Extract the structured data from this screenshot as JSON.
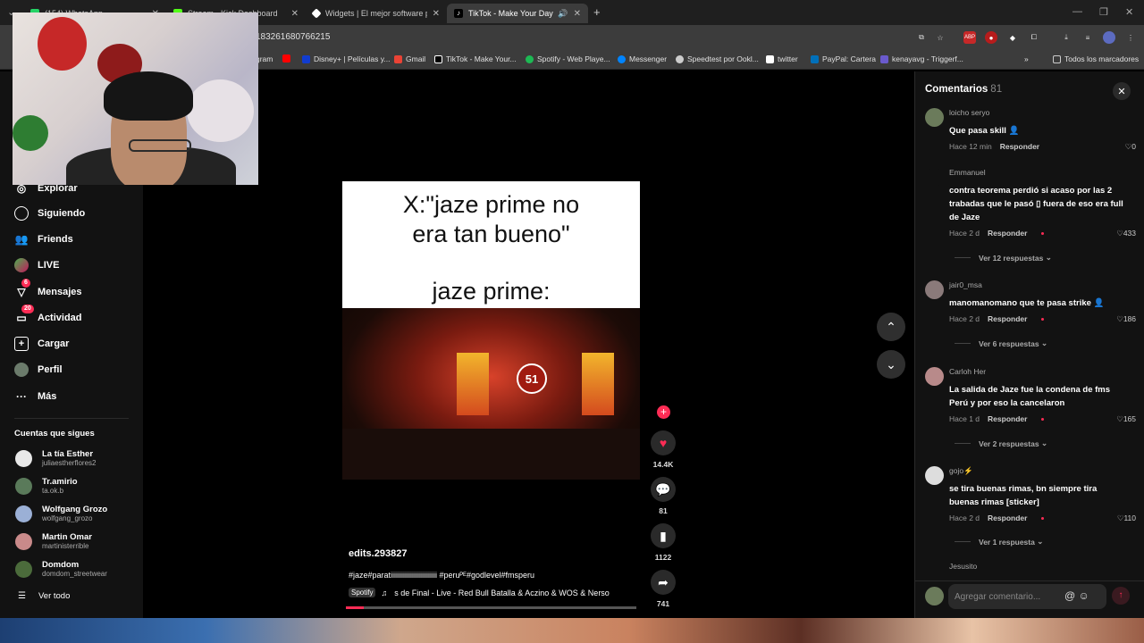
{
  "browser": {
    "tabs": [
      {
        "label": "(154) WhatsApp",
        "color": "#25d366"
      },
      {
        "label": "Stream - Kick Dashboard",
        "color": "#53fc18"
      },
      {
        "label": "Widgets | El mejor software pa",
        "color": "#ffffff"
      },
      {
        "label": "TikTok - Make Your Day",
        "color": "#ffffff"
      }
    ],
    "active_tab": 3,
    "url": "183261680766215",
    "bookmarks": [
      {
        "label": "gram",
        "color": "#c13584"
      },
      {
        "label": "",
        "color": "#ff0000"
      },
      {
        "label": "Disney+ | Películas y...",
        "color": "#113ccf"
      },
      {
        "label": "Gmail",
        "color": "#ea4335"
      },
      {
        "label": "TikTok - Make Your...",
        "color": "#ffffff"
      },
      {
        "label": "Spotify - Web Playe...",
        "color": "#1db954"
      },
      {
        "label": "Messenger",
        "color": "#0084ff"
      },
      {
        "label": "Speedtest por Ookl...",
        "color": "#cccccc"
      },
      {
        "label": "twitter",
        "color": "#ffffff"
      },
      {
        "label": "PayPal: Cartera",
        "color": "#0070ba"
      },
      {
        "label": "kenayavg - Triggerf...",
        "color": "#6a5acd"
      }
    ],
    "all_bookmarks_label": "Todos los marcadores",
    "extensions": [
      "ABP",
      "●",
      "◆"
    ]
  },
  "nav": {
    "items": [
      {
        "label": "Explorar",
        "icon": "compass-icon",
        "badge": ""
      },
      {
        "label": "Siguiendo",
        "icon": "following-icon",
        "badge": ""
      },
      {
        "label": "Friends",
        "icon": "friends-icon",
        "badge": ""
      },
      {
        "label": "LIVE",
        "icon": "live-icon",
        "badge": ""
      },
      {
        "label": "Mensajes",
        "icon": "messages-icon",
        "badge": "6"
      },
      {
        "label": "Actividad",
        "icon": "activity-icon",
        "badge": "20"
      },
      {
        "label": "Cargar",
        "icon": "upload-icon",
        "badge": ""
      },
      {
        "label": "Perfil",
        "icon": "profile-icon",
        "badge": ""
      },
      {
        "label": "Más",
        "icon": "more-icon",
        "badge": ""
      }
    ],
    "following_title": "Cuentas que sigues",
    "accounts": [
      {
        "name": "La tía Esther",
        "handle": "juliaestherflores2",
        "color": "#e8e8e8"
      },
      {
        "name": "Tr.amirio",
        "handle": "ta.ok.b",
        "color": "#5a7a5a"
      },
      {
        "name": "Wolfgang Grozo",
        "handle": "wolfgang_grozo",
        "color": "#9bb0d6"
      },
      {
        "name": "Martin Omar",
        "handle": "martinisterrible",
        "color": "#c98a8a"
      },
      {
        "name": "Domdom",
        "handle": "domdom_streetwear",
        "color": "#4b6b3b"
      }
    ],
    "see_all": "Ver todo"
  },
  "video": {
    "caption_line1": "X:\"jaze prime no",
    "caption_line2": "era tan bueno\"",
    "caption_line3": "jaze prime:",
    "stage_logo": "51",
    "author": "edits.293827",
    "hashtags": "#jaze#paratiiiiiiiiiiiiiiiiiiiiiiiiii #peruᴾᴱ#godlevel#fmsperu",
    "spotify_tag": "Spotify",
    "music": "s de Final - Live - Red Bull Batalla & Aczino & WOS & Nerso",
    "progress": 0.06
  },
  "actions": {
    "likes": "14.4K",
    "comments": "81",
    "saves": "1122",
    "shares": "741"
  },
  "comments": {
    "title": "Comentarios",
    "count": "81",
    "reply_label": "Responder",
    "input_placeholder": "Agregar comentario...",
    "items": [
      {
        "user": "loicho seryo",
        "text": "Que pasa skill 👤",
        "time": "Hace 12 min",
        "likes": "0",
        "replies": "",
        "color": "#6b7b5b"
      },
      {
        "user": "Emmanuel",
        "text": "contra teorema perdió si acaso por las 2 trabadas que le pasó ▯ fuera de eso era full de Jaze",
        "time": "Hace 2 d",
        "likes": "433",
        "replies": "Ver 12 respuestas",
        "color": "#121212"
      },
      {
        "user": "jair0_msa",
        "text": "manomanomano que te pasa strike 👤",
        "time": "Hace 2 d",
        "likes": "186",
        "replies": "Ver 6 respuestas",
        "color": "#8a7a7a"
      },
      {
        "user": "Carloh Her",
        "text": "La salida de Jaze fue la condena de fms Perú y por eso la cancelaron",
        "time": "Hace 1 d",
        "likes": "165",
        "replies": "Ver 2 respuestas",
        "color": "#b88a8a"
      },
      {
        "user": "gojo⚡",
        "text": "se tira buenas rimas, bn siempre tira buenas rimas [sticker]",
        "time": "Hace 2 d",
        "likes": "110",
        "replies": "Ver 1 respuesta",
        "color": "#dddddd"
      },
      {
        "user": "Jesusito",
        "text": "",
        "time": "",
        "likes": "",
        "replies": "",
        "color": "#121212"
      }
    ]
  }
}
